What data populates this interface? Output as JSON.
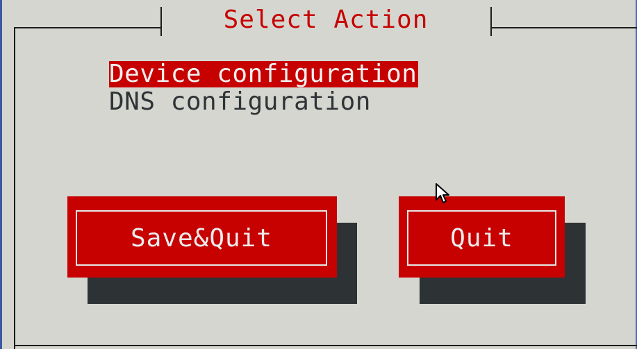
{
  "dialog": {
    "title": "Select Action"
  },
  "menu": {
    "items": [
      {
        "label": "Device configuration",
        "selected": true
      },
      {
        "label": "DNS configuration",
        "selected": false
      }
    ]
  },
  "buttons": {
    "save_quit": "Save&Quit",
    "quit": "Quit"
  },
  "colors": {
    "accent": "#c70000",
    "background": "#d5d6d0",
    "shadow": "#2d3235",
    "text": "#2e3336"
  },
  "icons": {
    "cursor": "mouse-pointer-icon"
  }
}
